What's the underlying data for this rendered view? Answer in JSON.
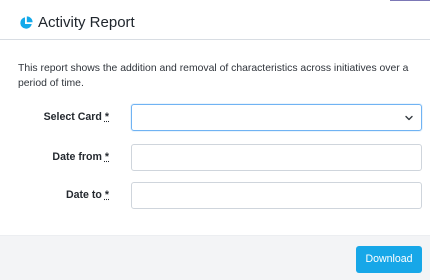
{
  "dialog": {
    "title": "Activity Report",
    "icon": "pie-chart-icon",
    "accent_color": "#14a9ea",
    "description": "This report shows the addition and removal of characteristics across initiatives over a period of time."
  },
  "form": {
    "select_card": {
      "label": "Select Card",
      "required_mark": "*",
      "value": ""
    },
    "date_from": {
      "label": "Date from",
      "required_mark": "*",
      "value": ""
    },
    "date_to": {
      "label": "Date to",
      "required_mark": "*",
      "value": ""
    }
  },
  "footer": {
    "download_label": "Download",
    "button_color": "#17a7e8",
    "background_color": "#f3f4f6"
  }
}
